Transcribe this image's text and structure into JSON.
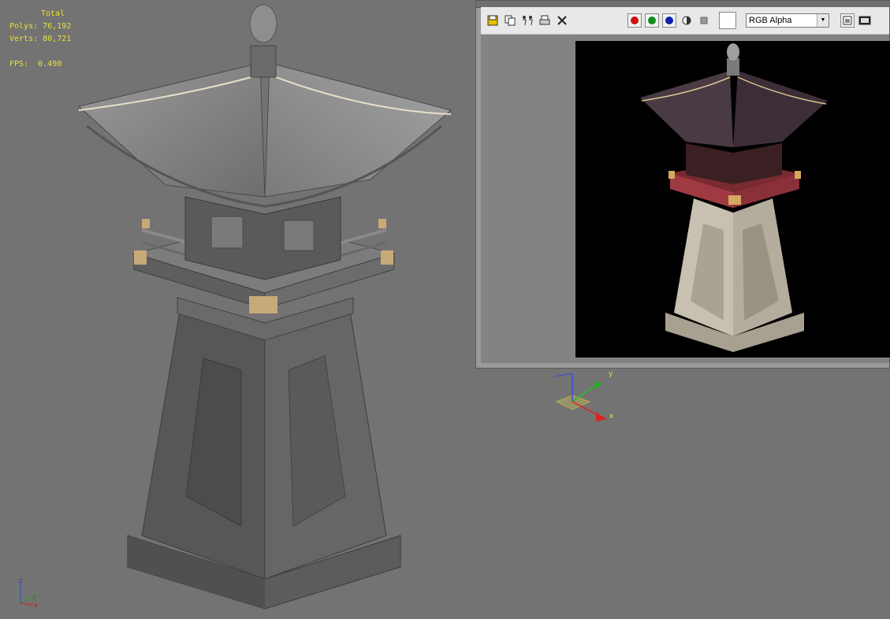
{
  "viewport": {
    "stats": {
      "header": "Total",
      "polys_label": "Polys:",
      "polys_value": "76,192",
      "verts_label": "Verts:",
      "verts_value": "80,721",
      "fps_label": "FPS:",
      "fps_value": "0.490"
    },
    "axis_labels": {
      "z": "z",
      "y": "y",
      "x": "x"
    },
    "gizmo_labels": {
      "y": "y",
      "x": "x"
    }
  },
  "frame_window": {
    "toolbar": {
      "save_icon": "save-icon",
      "clone_icon": "clone-icon",
      "track_icon": "track-icon",
      "print_icon": "print-icon",
      "clear_icon": "close-icon",
      "channel_colors": {
        "red": "#d01010",
        "green": "#109020",
        "blue": "#1020b0"
      },
      "channel_select_value": "RGB Alpha",
      "swatch_color": "#ffffff"
    }
  },
  "colors": {
    "viewport_bg": "#737373",
    "stats_text": "#e8e23a",
    "render_bg": "#000000"
  }
}
